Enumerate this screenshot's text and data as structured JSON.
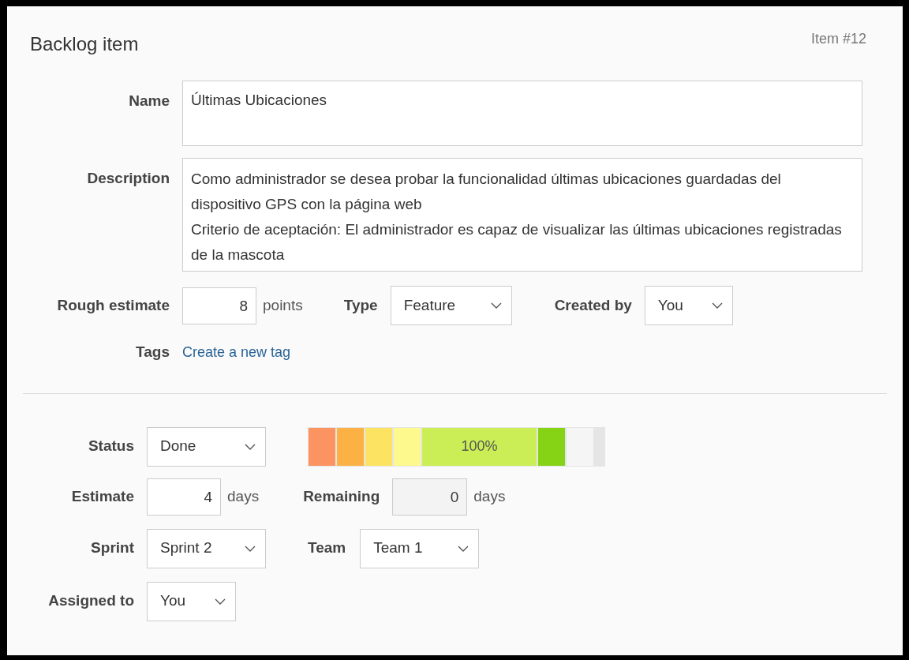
{
  "header": {
    "title": "Backlog item",
    "item_number": "Item #12"
  },
  "name": {
    "label": "Name",
    "value": "Últimas Ubicaciones"
  },
  "description": {
    "label": "Description",
    "value": "Como administrador se desea probar la funcionalidad últimas ubicaciones guardadas del dispositivo GPS con la página web\nCriterio de aceptación: El administrador es capaz de visualizar las últimas ubicaciones registradas de la mascota"
  },
  "rough_estimate": {
    "label": "Rough estimate",
    "value": "8",
    "unit": "points"
  },
  "type": {
    "label": "Type",
    "value": "Feature"
  },
  "created_by": {
    "label": "Created by",
    "value": "You"
  },
  "tags": {
    "label": "Tags",
    "link": "Create a new tag"
  },
  "status": {
    "label": "Status",
    "value": "Done"
  },
  "status_scale": [
    {
      "color": "#fb9461",
      "selected": false
    },
    {
      "color": "#fbb144",
      "selected": false
    },
    {
      "color": "#fce462",
      "selected": false
    },
    {
      "color": "#fef98c",
      "selected": false
    },
    {
      "color": "#cbee57",
      "selected": true,
      "label": "100%"
    },
    {
      "color": "#86d316",
      "selected": false
    },
    {
      "color": "#f5f5f5",
      "selected": false
    }
  ],
  "estimate": {
    "label": "Estimate",
    "value": "4",
    "unit": "days"
  },
  "remaining": {
    "label": "Remaining",
    "value": "0",
    "unit": "days",
    "disabled": true
  },
  "sprint": {
    "label": "Sprint",
    "value": "Sprint 2"
  },
  "team": {
    "label": "Team",
    "value": "Team 1"
  },
  "assigned_to": {
    "label": "Assigned to",
    "value": "You"
  }
}
